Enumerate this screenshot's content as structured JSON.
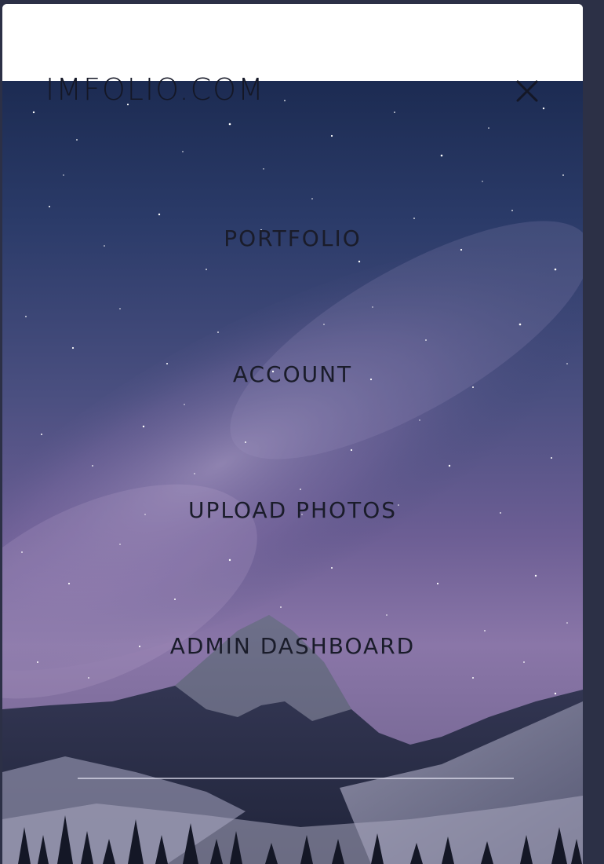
{
  "header": {
    "brand": "IMFOLIO.COM",
    "close_icon": "close-icon"
  },
  "menu": {
    "items": [
      {
        "label": "PORTFOLIO"
      },
      {
        "label": "ACCOUNT"
      },
      {
        "label": "UPLOAD PHOTOS"
      },
      {
        "label": "ADMIN DASHBOARD"
      }
    ]
  },
  "background": {
    "image": "starry-night-mountain",
    "colors": {
      "sky_top": "#1c2b52",
      "sky_mid": "#6c5e94",
      "mountain": "#2e3350",
      "snow": "#b7b6c9",
      "frame": "#2c3046"
    }
  }
}
